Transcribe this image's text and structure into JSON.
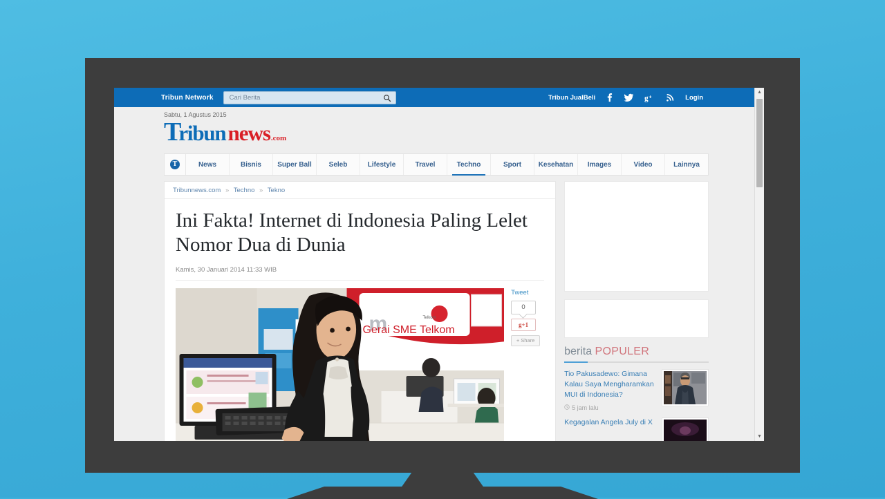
{
  "browser": {
    "topbar": {
      "network_label": "Tribun Network",
      "search_placeholder": "Cari Berita",
      "search_value": "",
      "jualbeli_label": "Tribun JualBeli",
      "login_label": "Login",
      "social": [
        "facebook-icon",
        "twitter-icon",
        "google-plus-icon",
        "rss-icon"
      ],
      "bg_color": "#0d6cb7"
    },
    "masthead": {
      "date": "Sabtu, 1 Agustus 2015",
      "logo": {
        "first_letter": "T",
        "part1": "ribun",
        "part2": "news",
        "suffix": ".com",
        "color1": "#0d6cb7",
        "color2": "#d91f26"
      }
    },
    "nav": {
      "home_icon": "tribun-home-icon",
      "items": [
        {
          "label": "News",
          "active": false
        },
        {
          "label": "Bisnis",
          "active": false
        },
        {
          "label": "Super Ball",
          "active": false
        },
        {
          "label": "Seleb",
          "active": false
        },
        {
          "label": "Lifestyle",
          "active": false
        },
        {
          "label": "Travel",
          "active": false
        },
        {
          "label": "Techno",
          "active": true
        },
        {
          "label": "Sport",
          "active": false
        },
        {
          "label": "Kesehatan",
          "active": false
        },
        {
          "label": "Images",
          "active": false
        },
        {
          "label": "Video",
          "active": false
        },
        {
          "label": "Lainnya",
          "active": false
        }
      ],
      "active_color": "#1c72b8"
    },
    "article": {
      "breadcrumb": [
        "Tribunnews.com",
        "Techno",
        "Tekno"
      ],
      "breadcrumb_separator": "»",
      "headline": "Ini Fakta! Internet di Indonesia Paling Lelet Nomor Dua di Dunia",
      "timestamp": "Kamis, 30 Januari 2014 11:33 WIB",
      "photo_caption": "Gerai SME Telkom"
    },
    "share": {
      "tweet_label": "Tweet",
      "tweet_count": "0",
      "gplus_label": "g+1",
      "share_label": "+ Share"
    },
    "sidebar": {
      "ads": [
        "ad-slot-large",
        "ad-slot-small"
      ],
      "popular_heading": {
        "part1": "berita ",
        "part2": "POPULER"
      },
      "popular_items": [
        {
          "title": "Tio Pakusadewo: Gimana Kalau Saya Mengharamkan MUI di Indonesia?",
          "time": "5 jam lalu",
          "thumb": "portrait-man-thumb"
        },
        {
          "title": "Kegagalan Angela July di X",
          "time": "",
          "thumb": "stage-dark-thumb"
        }
      ]
    },
    "scrollbar": {
      "up_arrow": "▲",
      "down_arrow": "▼"
    }
  },
  "scene": {
    "background_color": "#3fb1dc",
    "monitor_color": "#3d3d3d"
  }
}
